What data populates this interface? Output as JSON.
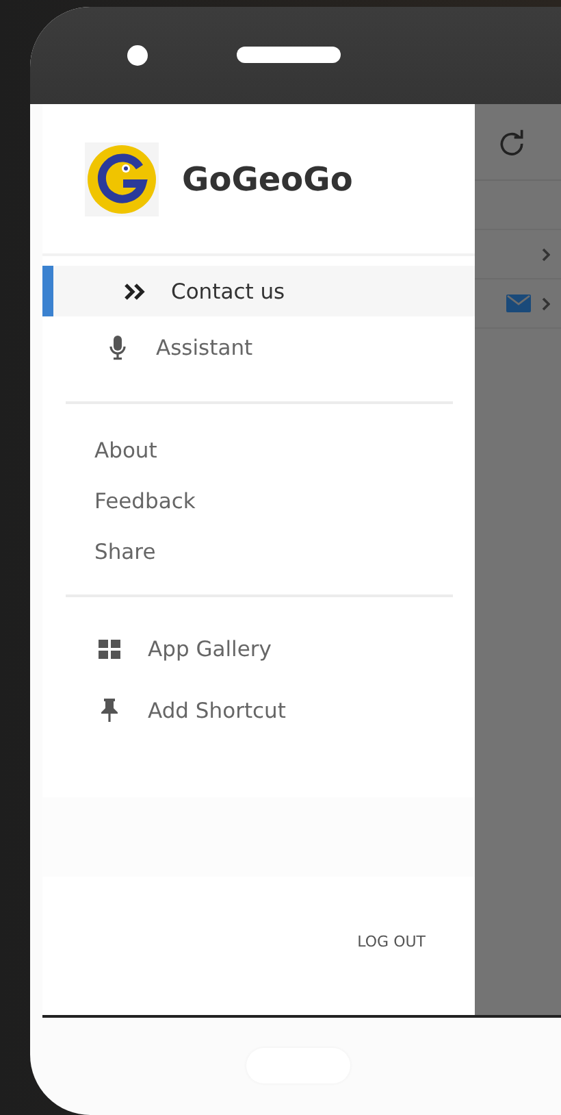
{
  "drawer": {
    "app_name": "GoGeoGo",
    "sections": [
      {
        "items": [
          {
            "label": "Contact us",
            "kind": "chevrons",
            "selected": true
          },
          {
            "label": "Assistant",
            "kind": "mic",
            "selected": false
          }
        ]
      },
      {
        "items": [
          {
            "label": "About",
            "kind": "text",
            "selected": false
          },
          {
            "label": "Feedback",
            "kind": "text",
            "selected": false
          },
          {
            "label": "Share",
            "kind": "text",
            "selected": false
          }
        ]
      },
      {
        "items": [
          {
            "label": "App Gallery",
            "kind": "grid",
            "selected": false
          },
          {
            "label": "Add Shortcut",
            "kind": "pin",
            "selected": false
          }
        ]
      }
    ],
    "logout": "LOG OUT"
  }
}
